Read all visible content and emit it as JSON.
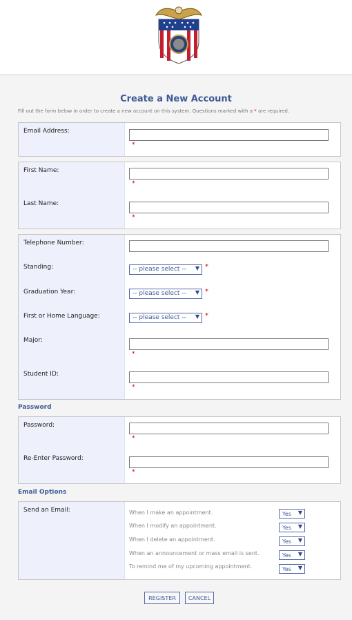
{
  "page": {
    "title": "Create a New Account",
    "intro_before": "Fill out the form below in order to create a new account on this system. Questions marked with a ",
    "intro_star": "*",
    "intro_after": " are required."
  },
  "account": {
    "email_label": "Email Address:",
    "first_name_label": "First Name:",
    "last_name_label": "Last Name:"
  },
  "profile": {
    "telephone_label": "Telephone Number:",
    "standing_label": "Standing:",
    "standing_value": "-- please select --",
    "graduation_label": "Graduation Year:",
    "graduation_value": "-- please select --",
    "language_label": "First or Home Language:",
    "language_value": "-- please select --",
    "major_label": "Major:",
    "student_id_label": "Student ID:"
  },
  "password": {
    "heading": "Password",
    "password_label": "Password:",
    "reenter_label": "Re-Enter Password:"
  },
  "email_options": {
    "heading": "Email Options",
    "send_label": "Send an Email:",
    "options": [
      {
        "text": "When I make an appointment.",
        "value": "Yes"
      },
      {
        "text": "When I modify an appointment.",
        "value": "Yes"
      },
      {
        "text": "When I delete an appointment.",
        "value": "Yes"
      },
      {
        "text": "When an announcement or mass email is sent.",
        "value": "Yes"
      },
      {
        "text": "To remind me of my upcoming appointment.",
        "value": "Yes"
      }
    ]
  },
  "required_mark": "*",
  "buttons": {
    "register": "REGISTER",
    "cancel": "CANCEL"
  },
  "icons": {
    "logo": "crest-logo-icon",
    "dropdown": "chevron-down-icon"
  },
  "colors": {
    "accent": "#3d5a96",
    "required": "#cc0000",
    "label_bg": "#eef0fb"
  }
}
